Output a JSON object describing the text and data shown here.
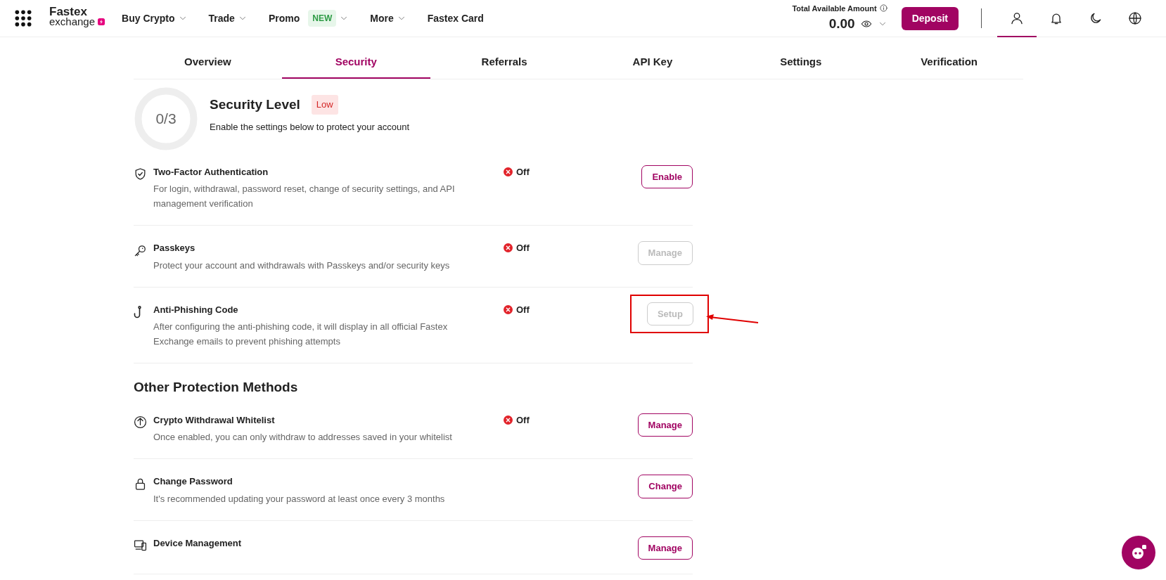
{
  "header": {
    "logo": {
      "line1": "Fastex",
      "line2": "exchange"
    },
    "nav": [
      {
        "label": "Buy Crypto",
        "caret": true
      },
      {
        "label": "Trade",
        "caret": true
      },
      {
        "label": "Promo",
        "badge": "NEW",
        "caret": true
      },
      {
        "label": "More",
        "caret": true
      },
      {
        "label": "Fastex Card",
        "caret": false
      }
    ],
    "balance": {
      "label": "Total Available Amount",
      "amount": "0.00"
    },
    "deposit": "Deposit",
    "icons": [
      {
        "kind": "user",
        "selected": true
      },
      {
        "kind": "bell",
        "selected": false
      },
      {
        "kind": "moon",
        "selected": false
      },
      {
        "kind": "globe",
        "selected": false
      }
    ]
  },
  "tabs": [
    {
      "label": "Overview",
      "selected": false
    },
    {
      "label": "Security",
      "selected": true
    },
    {
      "label": "Referrals",
      "selected": false
    },
    {
      "label": "API Key",
      "selected": false
    },
    {
      "label": "Settings",
      "selected": false
    },
    {
      "label": "Verification",
      "selected": false
    }
  ],
  "security_level": {
    "score": "0/3",
    "title": "Security Level",
    "badge": "Low",
    "description": "Enable the settings below to protect your account"
  },
  "methods": [
    {
      "title": "Two-Factor Authentication",
      "description": "For login, withdrawal, password reset, change of security settings, and API management verification",
      "status": "Off",
      "action": {
        "label": "Enable",
        "disabled": false
      }
    },
    {
      "title": "Passkeys",
      "description": "Protect your account and withdrawals with Passkeys and/or security keys",
      "status": "Off",
      "action": {
        "label": "Manage",
        "disabled": true
      }
    },
    {
      "title": "Anti-Phishing Code",
      "description": "After configuring the anti-phishing code, it will display in all official Fastex Exchange emails to prevent phishing attempts",
      "status": "Off",
      "action": {
        "label": "Setup",
        "disabled": true
      },
      "highlighted": true
    }
  ],
  "other": {
    "heading": "Other Protection Methods",
    "methods": [
      {
        "title": "Crypto Withdrawal Whitelist",
        "description": "Once enabled, you can only withdraw to addresses saved in your whitelist",
        "status": "Off",
        "action": {
          "label": "Manage",
          "disabled": false
        }
      },
      {
        "title": "Change Password",
        "description": "It's recommended updating your password at least once every 3 months",
        "action": {
          "label": "Change",
          "disabled": false
        }
      },
      {
        "title": "Device Management",
        "action": {
          "label": "Manage",
          "disabled": false
        }
      }
    ]
  }
}
